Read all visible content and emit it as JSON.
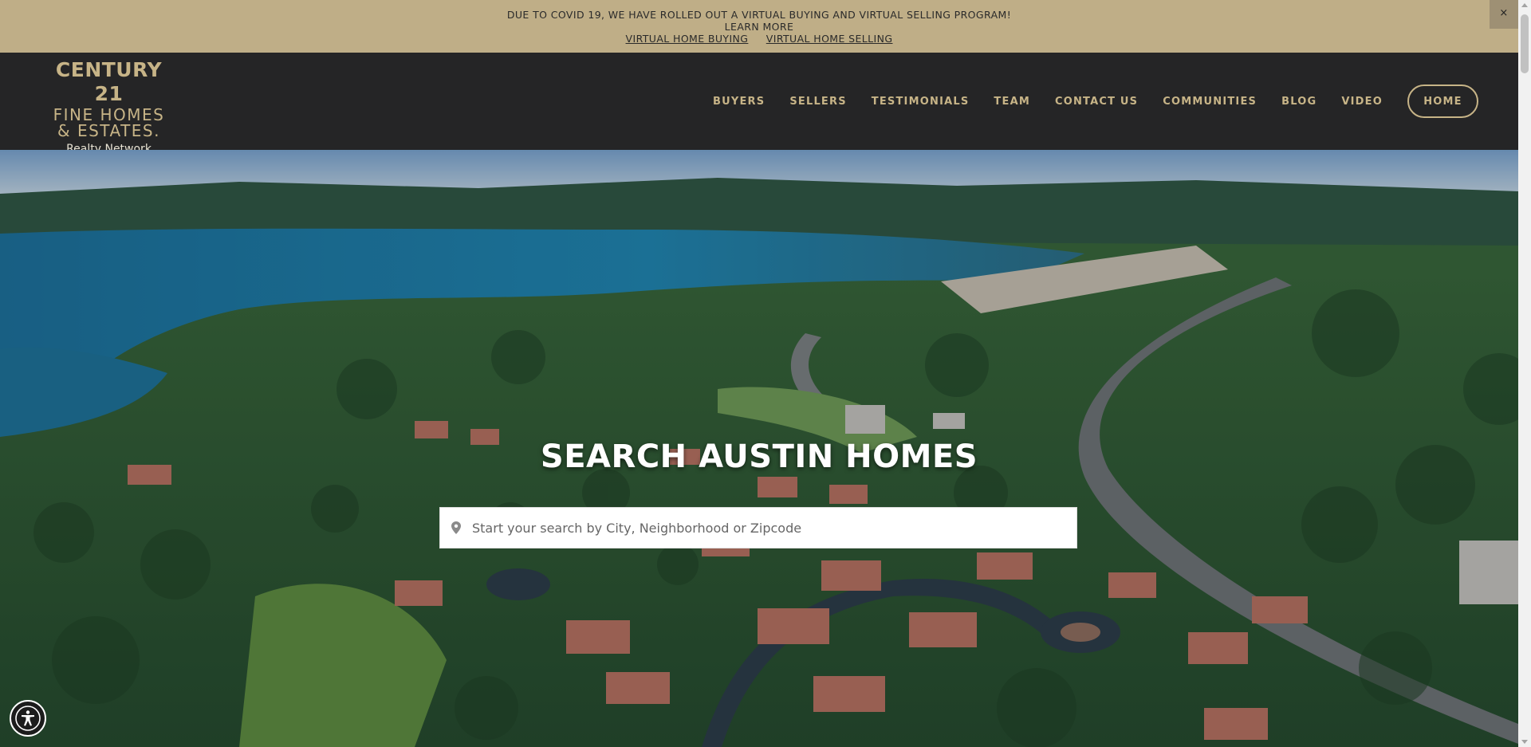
{
  "announcement": {
    "line1": "DUE TO COVID 19, WE HAVE ROLLED OUT A VIRTUAL BUYING AND VIRTUAL SELLING PROGRAM!",
    "line2": "LEARN MORE",
    "link_buying": "VIRTUAL HOME BUYING",
    "link_selling": "VIRTUAL HOME SELLING",
    "close_label": "×"
  },
  "logo": {
    "line1": "CENTURY 21",
    "line2": "FINE HOMES",
    "line3": "& ESTATES.",
    "line4": "Realty Network"
  },
  "nav": {
    "items": [
      "BUYERS",
      "SELLERS",
      "TESTIMONIALS",
      "TEAM",
      "CONTACT US",
      "COMMUNITIES",
      "BLOG",
      "VIDEO"
    ],
    "home_button": "HOME"
  },
  "hero": {
    "title": "SEARCH AUSTIN HOMES",
    "search_placeholder": "Start your search by City, Neighborhood or Zipcode",
    "search_value": ""
  },
  "colors": {
    "announcement_bg": "#bfae87",
    "header_bg": "#252526",
    "gold_accent": "#c7b487"
  },
  "icons": {
    "search": "map-pin-icon",
    "accessibility": "accessibility-icon",
    "close": "close-icon"
  }
}
